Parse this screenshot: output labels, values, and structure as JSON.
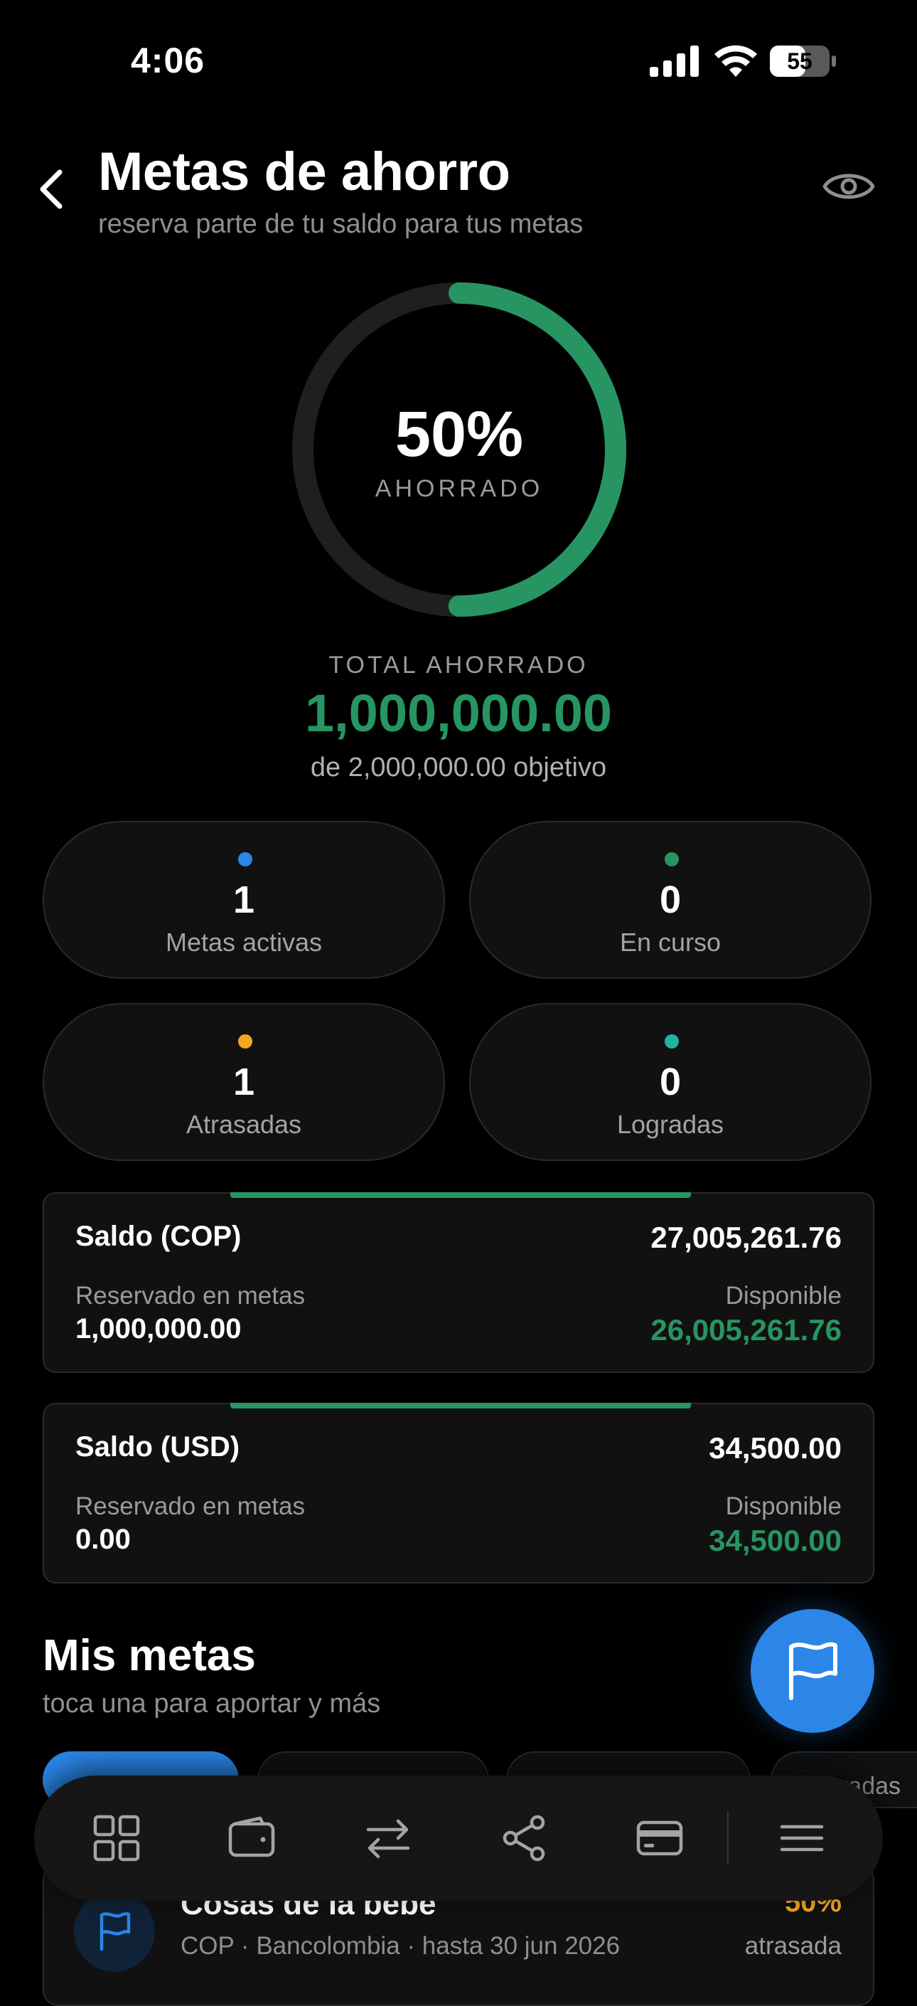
{
  "status_bar": {
    "time": "4:06",
    "battery": "55"
  },
  "header": {
    "title": "Metas de ahorro",
    "subtitle": "reserva parte de tu saldo para tus metas"
  },
  "progress": {
    "percent_text": "50%",
    "percent_value": 0.5,
    "label": "AHORRADO",
    "ring_color": "#279562",
    "track_color": "#1f1f21"
  },
  "totals": {
    "label": "TOTAL AHORRADO",
    "value": "1,000,000.00",
    "goal": "de 2,000,000.00 objetivo"
  },
  "stats": [
    {
      "value": "1",
      "label": "Metas activas",
      "color": "#2b86e8"
    },
    {
      "value": "0",
      "label": "En curso",
      "color": "#279562"
    },
    {
      "value": "1",
      "label": "Atrasadas",
      "color": "#f5a623"
    },
    {
      "value": "0",
      "label": "Logradas",
      "color": "#1fb5a0"
    }
  ],
  "balances": [
    {
      "name": "Saldo (COP)",
      "amount": "27,005,261.76",
      "reserved_label": "Reservado en metas",
      "reserved_value": "1,000,000.00",
      "available_label": "Disponible",
      "available_value": "26,005,261.76"
    },
    {
      "name": "Saldo (USD)",
      "amount": "34,500.00",
      "reserved_label": "Reservado en metas",
      "reserved_value": "0.00",
      "available_label": "Disponible",
      "available_value": "34,500.00"
    }
  ],
  "goals_section": {
    "title": "Mis metas",
    "subtitle": "toca una para aportar y más",
    "filters": [
      "",
      "",
      "",
      "radas"
    ],
    "items": [
      {
        "name": "Cosas de la bebe",
        "meta": "COP · Bancolombia · hasta 30 jun 2026",
        "percent": "50%",
        "status": "atrasada"
      }
    ]
  },
  "nav": {
    "icons": [
      "grid-icon",
      "wallet-icon",
      "transfer-icon",
      "share-icon",
      "card-icon",
      "menu-icon"
    ]
  }
}
